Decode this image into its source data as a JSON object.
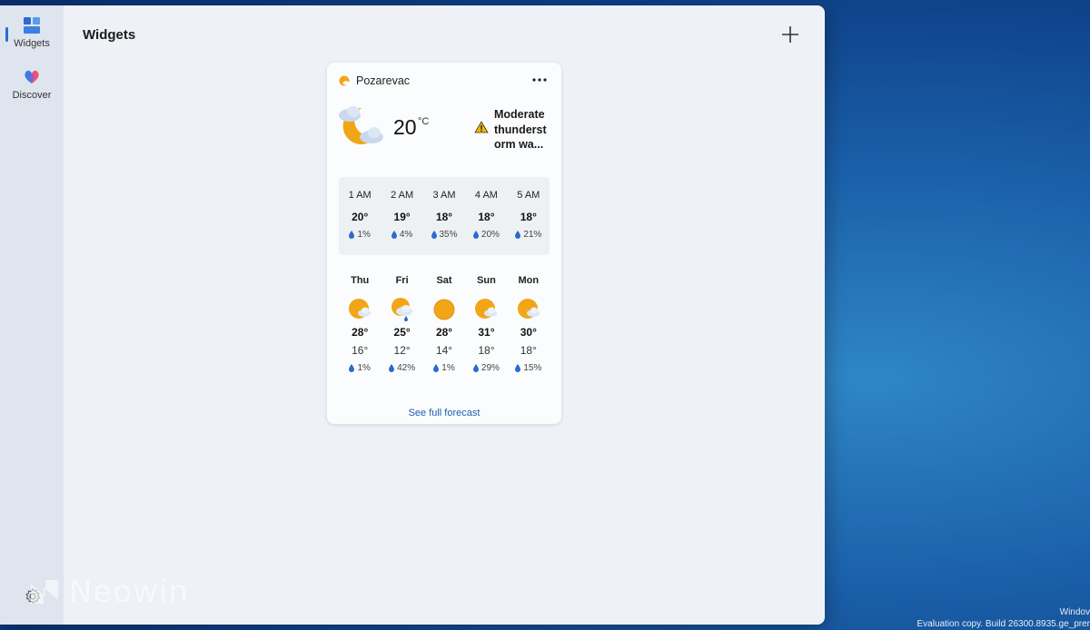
{
  "rail": {
    "widgets_label": "Widgets",
    "discover_label": "Discover"
  },
  "header": {
    "title": "Widgets"
  },
  "watermark": {
    "text": "Neowin"
  },
  "weather": {
    "location": "Pozarevac",
    "current_temp": "20",
    "unit": "°C",
    "alert": "Moderate thunderstorm wa...",
    "hourly": [
      {
        "time": "1 AM",
        "temp": "20°",
        "precip": "1%"
      },
      {
        "time": "2 AM",
        "temp": "19°",
        "precip": "4%"
      },
      {
        "time": "3 AM",
        "temp": "18°",
        "precip": "35%"
      },
      {
        "time": "4 AM",
        "temp": "18°",
        "precip": "20%"
      },
      {
        "time": "5 AM",
        "temp": "18°",
        "precip": "21%"
      }
    ],
    "daily": [
      {
        "day": "Thu",
        "icon": "partly-cloudy-icon",
        "high": "28°",
        "low": "16°",
        "precip": "1%"
      },
      {
        "day": "Fri",
        "icon": "cloudy-rain-icon",
        "high": "25°",
        "low": "12°",
        "precip": "42%"
      },
      {
        "day": "Sat",
        "icon": "sunny-icon",
        "high": "28°",
        "low": "14°",
        "precip": "1%"
      },
      {
        "day": "Sun",
        "icon": "partly-cloudy-icon",
        "high": "31°",
        "low": "18°",
        "precip": "29%"
      },
      {
        "day": "Mon",
        "icon": "partly-cloudy-icon",
        "high": "30°",
        "low": "18°",
        "precip": "15%"
      }
    ],
    "see_full_forecast": "See full forecast"
  },
  "desktop": {
    "line1": "Windov",
    "line2": "Evaluation copy. Build 26300.8935.ge_prer"
  },
  "colors": {
    "accent": "#2a6bd1",
    "link": "#1d5fb0",
    "sun": "#f2a516"
  }
}
